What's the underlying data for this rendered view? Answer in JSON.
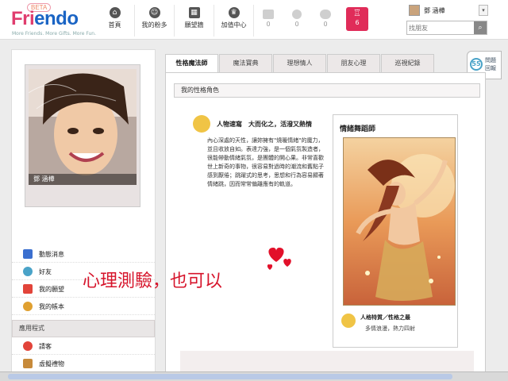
{
  "logo": {
    "beta": "BETA",
    "name_part1": "Fri",
    "name_part2": "endo",
    "tagline": "More Friends. More Gifts. More Fun."
  },
  "nav": {
    "items": [
      {
        "label": "首頁",
        "icon": "home-icon"
      },
      {
        "label": "我的粉多",
        "icon": "profile-icon"
      },
      {
        "label": "願望牆",
        "icon": "wall-icon"
      },
      {
        "label": "加值中心",
        "icon": "crown-icon"
      }
    ],
    "counters": [
      {
        "icon": "mail-icon",
        "count": "0"
      },
      {
        "icon": "info-icon",
        "count": "0"
      },
      {
        "icon": "chat-icon",
        "count": "0"
      }
    ],
    "trophy": {
      "icon": "trophy-icon",
      "count": "6"
    }
  },
  "user": {
    "name": "鄧 涵樺"
  },
  "search": {
    "placeholder": "找朋友"
  },
  "help": {
    "label": "問題回報"
  },
  "profile": {
    "name": "鄧 涵樺"
  },
  "sidebar": {
    "items": [
      {
        "label": "動態消息",
        "color": "#3b6fcf"
      },
      {
        "label": "好友",
        "color": "#4aa3c8"
      },
      {
        "label": "我的願望",
        "color": "#e2443a"
      },
      {
        "label": "我的帳本",
        "color": "#e0a030"
      }
    ],
    "apps_header": "應用程式",
    "apps": [
      {
        "label": "請客",
        "color": "#e2443a"
      },
      {
        "label": "虛擬禮物",
        "color": "#c78a3a"
      }
    ]
  },
  "tabs": [
    "性格魔法師",
    "魔法寶典",
    "理想情人",
    "朋友心理",
    "巡視紀錄"
  ],
  "main": {
    "section_title": "我的性格角色",
    "trait_title": "人物速寫　大而化之，活潑又熱情",
    "trait_desc": "內心深處的天性，讓妳擁有\"燒暖情緒\"的魔力，並且收放自如。表達力強，是一個氣氛製造者，很能帶動情緒氣氛，是團體的開心果。非常喜歡世上新奇的事物，很容易對過時的潮流和舊點子感到厭倦；跳躍式的思考，思想和行為容易顯著情緒跳，因而常常偏離應有的軌道。",
    "card_title": "情緒舞蹈師",
    "card_foot_title": "人格特質／性格之最",
    "card_foot_desc": "多情浪漫，熱力四射"
  },
  "overlay": {
    "text": "心理測驗，也可以"
  },
  "colors": {
    "brand_pink": "#e03d6e",
    "brand_blue": "#1a64c4",
    "accent_red": "#d6142b"
  }
}
